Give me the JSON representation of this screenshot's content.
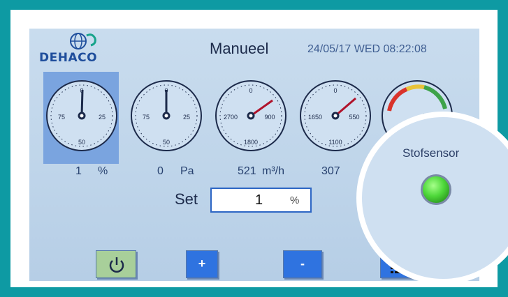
{
  "header": {
    "logo_text": "DEHACO",
    "title": "Manueel",
    "datetime": "24/05/17 WED 08:22:08"
  },
  "gauges": [
    {
      "labels": [
        "0",
        "25",
        "50",
        "75"
      ],
      "reading": "1",
      "unit": "%",
      "selected": true
    },
    {
      "labels": [
        "0",
        "25",
        "50",
        "75"
      ],
      "reading": "0",
      "unit": "Pa",
      "selected": false
    },
    {
      "labels": [
        "0",
        "900",
        "1800",
        "2700"
      ],
      "reading": "521",
      "unit": "m³/h",
      "selected": false
    },
    {
      "labels": [
        "0",
        "550",
        "1100",
        "1650"
      ],
      "reading": "307",
      "unit": "",
      "selected": false
    }
  ],
  "partial_gauge": {
    "stars": "★★★★"
  },
  "set": {
    "label": "Set",
    "value": "1",
    "unit": "%"
  },
  "sensor": {
    "label": "Stofsensor",
    "status_color": "#4ed83a"
  },
  "buttons": {
    "power_icon": "power-icon",
    "plus": "+",
    "minus": "-",
    "menu_icon": "list-icon"
  },
  "colors": {
    "frame": "#0e9aa3",
    "accent": "#2f73e0",
    "selected_gauge": "#7aa4df",
    "needle": "#b0132b"
  }
}
